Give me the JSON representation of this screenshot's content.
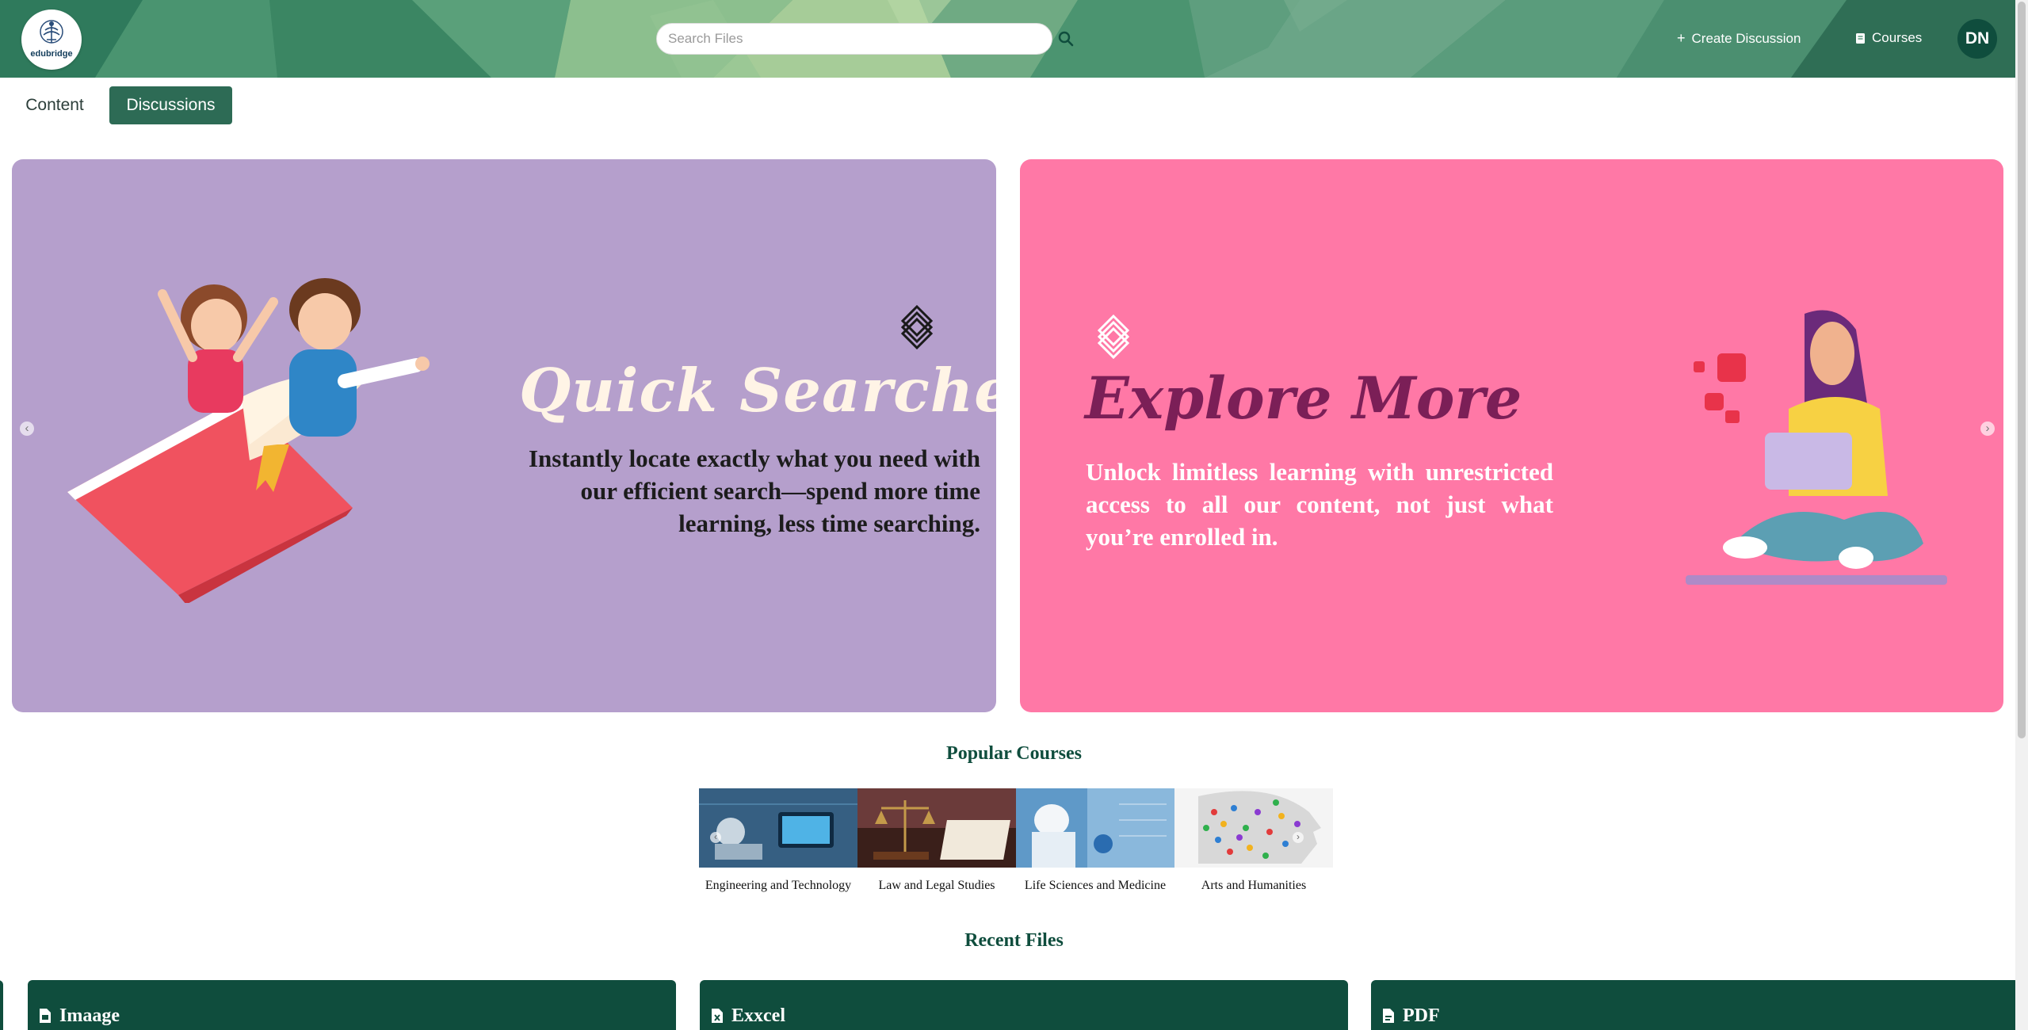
{
  "header": {
    "logo_text": "edubridge",
    "search_placeholder": "Search Files",
    "nav": {
      "create_discussion": "Create Discussion",
      "courses": "Courses"
    },
    "avatar_initials": "DN"
  },
  "tabs": [
    {
      "label": "Content",
      "active": false
    },
    {
      "label": "Discussions",
      "active": true
    }
  ],
  "carousel": {
    "slides": [
      {
        "title": "Quick Searches",
        "description": "Instantly locate exactly what you need with our efficient search—spend more time learning, less time searching."
      },
      {
        "title": "Explore More",
        "description": "Unlock limitless learning with unrestricted access to all our content, not just what you’re enrolled in."
      }
    ],
    "prev_symbol": "‹",
    "next_symbol": "›"
  },
  "popular_courses": {
    "title": "Popular Courses",
    "items": [
      {
        "label": "Engineering and Technology"
      },
      {
        "label": "Law and Legal Studies"
      },
      {
        "label": "Life Sciences and Medicine"
      },
      {
        "label": "Arts and Humanities"
      }
    ]
  },
  "recent_files": {
    "title": "Recent Files",
    "items": [
      {
        "name": "Imaage",
        "icon": "image-file-icon"
      },
      {
        "name": "Exxcel",
        "icon": "excel-file-icon"
      },
      {
        "name": "PDF",
        "icon": "pdf-file-icon"
      }
    ]
  },
  "colors": {
    "primary": "#0f4d3d",
    "tab_active": "#2d6b55",
    "banner_purple": "#b59fcc",
    "banner_pink": "#ff78a6",
    "title_maroon": "#7b1f57"
  }
}
